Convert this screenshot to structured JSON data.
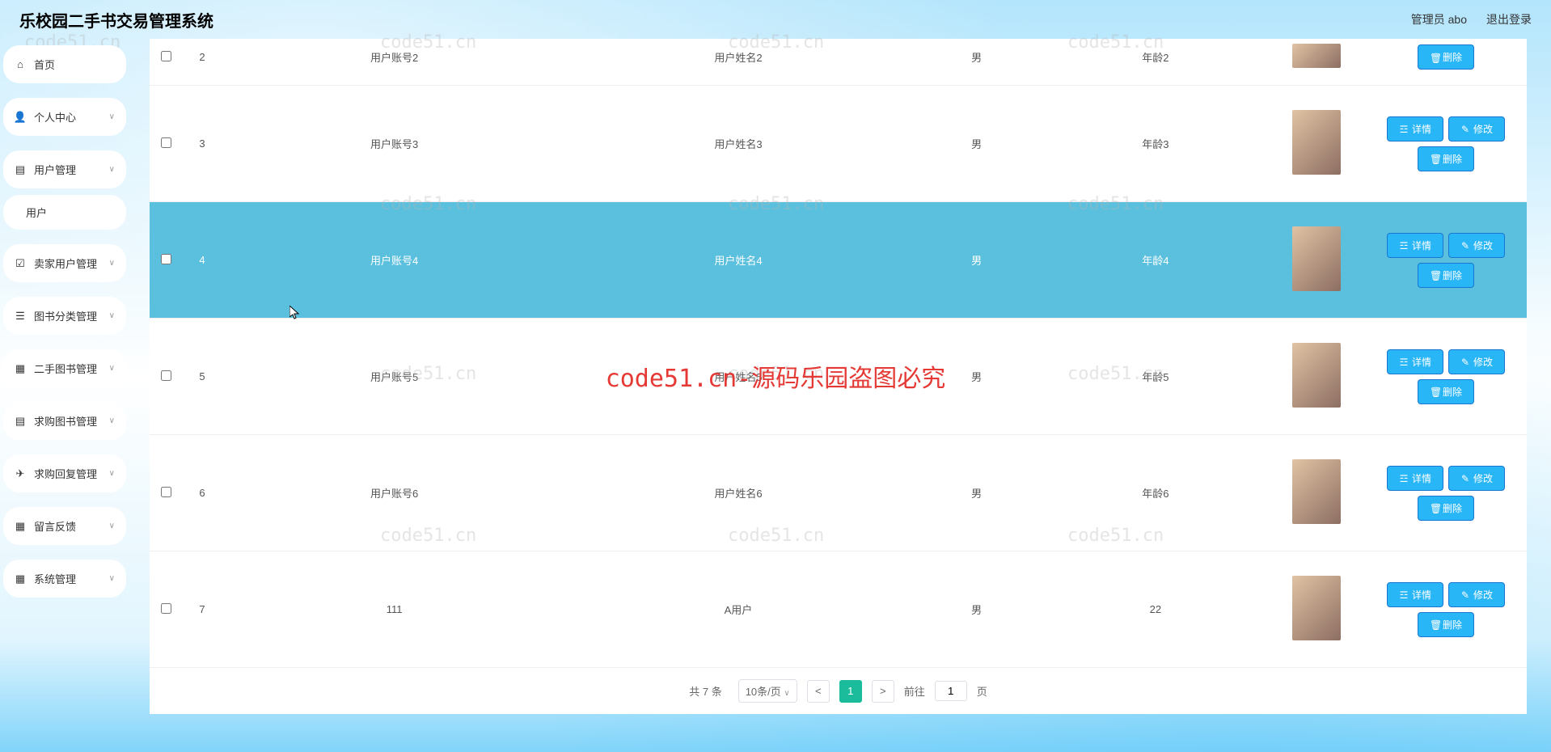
{
  "header": {
    "title": "乐校园二手书交易管理系统",
    "admin": "管理员 abo",
    "logout": "退出登录"
  },
  "sidebar": {
    "items": [
      {
        "label": "首页",
        "icon": "home"
      },
      {
        "label": "个人中心",
        "icon": "user",
        "expandable": true
      },
      {
        "label": "用户管理",
        "icon": "file",
        "expandable": true
      },
      {
        "label": "卖家用户管理",
        "icon": "check",
        "expandable": true
      },
      {
        "label": "图书分类管理",
        "icon": "list",
        "expandable": true
      },
      {
        "label": "二手图书管理",
        "icon": "grid",
        "expandable": true
      },
      {
        "label": "求购图书管理",
        "icon": "file",
        "expandable": true
      },
      {
        "label": "求购回复管理",
        "icon": "send",
        "expandable": true
      },
      {
        "label": "留言反馈",
        "icon": "grid",
        "expandable": true
      },
      {
        "label": "系统管理",
        "icon": "grid",
        "expandable": true
      }
    ],
    "sub": {
      "label": "用户"
    }
  },
  "actions": {
    "detail": "详情",
    "edit": "修改",
    "delete": "删除"
  },
  "rows": [
    {
      "idx": "2",
      "account": "用户账号2",
      "name": "用户姓名2",
      "gender": "男",
      "age": "年龄2",
      "highlight": false,
      "partial": true
    },
    {
      "idx": "3",
      "account": "用户账号3",
      "name": "用户姓名3",
      "gender": "男",
      "age": "年龄3",
      "highlight": false
    },
    {
      "idx": "4",
      "account": "用户账号4",
      "name": "用户姓名4",
      "gender": "男",
      "age": "年龄4",
      "highlight": true
    },
    {
      "idx": "5",
      "account": "用户账号5",
      "name": "用户姓名5",
      "gender": "男",
      "age": "年龄5",
      "highlight": false
    },
    {
      "idx": "6",
      "account": "用户账号6",
      "name": "用户姓名6",
      "gender": "男",
      "age": "年龄6",
      "highlight": false
    },
    {
      "idx": "7",
      "account": "111",
      "name": "A用户",
      "gender": "男",
      "age": "22",
      "highlight": false
    }
  ],
  "pager": {
    "total": "共 7 条",
    "pageSize": "10条/页",
    "current": "1",
    "jumpLabel": "前往",
    "jumpValue": "1",
    "pageUnit": "页"
  },
  "watermark": {
    "repeat": "code51.cn",
    "main": "code51.cn-源码乐园盗图必究"
  }
}
